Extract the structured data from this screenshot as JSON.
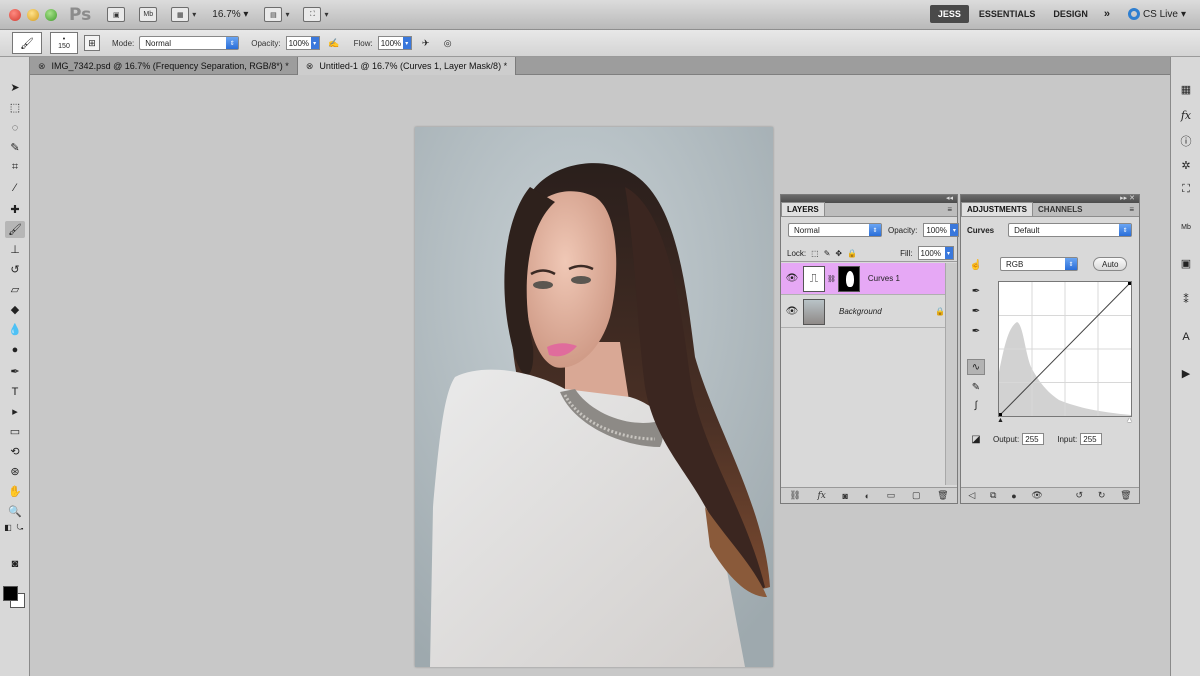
{
  "appbar": {
    "logo": "Ps",
    "mb_label": "Mb",
    "zoom": "16.7%",
    "workspaces": [
      "JESS",
      "ESSENTIALS",
      "DESIGN"
    ],
    "more": "»",
    "cs_live": "CS Live"
  },
  "options": {
    "brush_size": "150",
    "mode_label": "Mode:",
    "mode_value": "Normal",
    "opacity_label": "Opacity:",
    "opacity_value": "100%",
    "flow_label": "Flow:",
    "flow_value": "100%"
  },
  "tabs": [
    {
      "label": "IMG_7342.psd @ 16.7% (Frequency Separation, RGB/8*) *"
    },
    {
      "label": "Untitled-1 @ 16.7% (Curves 1, Layer Mask/8) *"
    }
  ],
  "layers_panel": {
    "tab": "LAYERS",
    "blend_mode": "Normal",
    "opacity_label": "Opacity:",
    "opacity_value": "100%",
    "lock_label": "Lock:",
    "fill_label": "Fill:",
    "fill_value": "100%",
    "layers": [
      {
        "name": "Curves 1",
        "selected": true
      },
      {
        "name": "Background",
        "selected": false
      }
    ]
  },
  "adjustments_panel": {
    "tabs": [
      "ADJUSTMENTS",
      "CHANNELS"
    ],
    "type_label": "Curves",
    "preset": "Default",
    "channel": "RGB",
    "auto_label": "Auto",
    "output_label": "Output:",
    "output_value": "255",
    "input_label": "Input:",
    "input_value": "255"
  },
  "colors": {
    "selected_layer": "#e6a8f5",
    "accent_blue": "#2a6ed8"
  }
}
